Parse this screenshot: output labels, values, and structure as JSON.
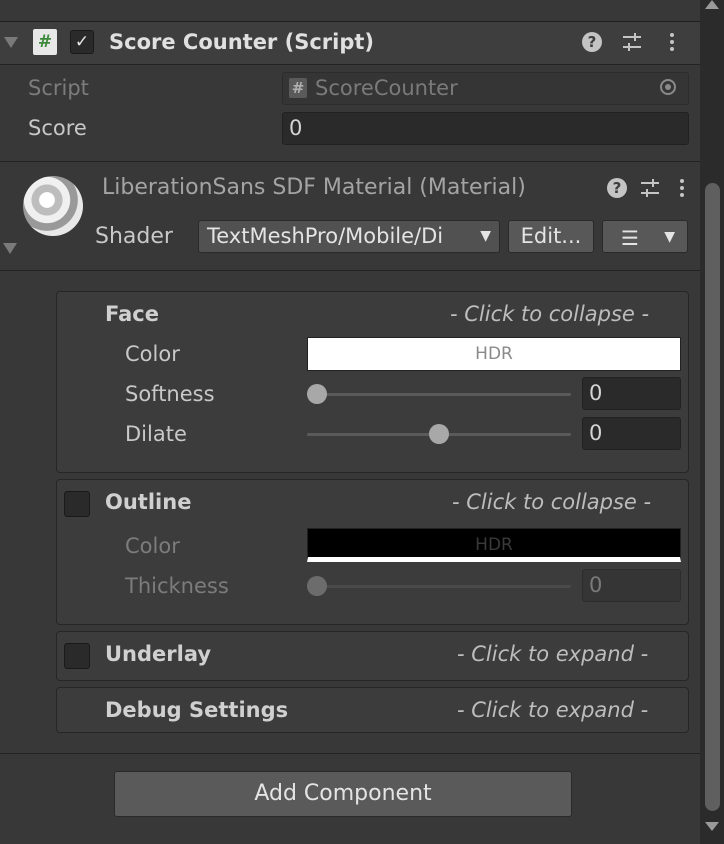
{
  "component": {
    "title": "Score Counter (Script)",
    "enabled": true,
    "icon": "hash-script-icon",
    "icon_glyph": "#",
    "checkbox_glyph": "✓",
    "help_glyph": "?",
    "settings_glyph": "⊹",
    "menu_glyph": "⋮",
    "fields": {
      "script_label": "Script",
      "script_value": "ScoreCounter",
      "script_icon_glyph": "#",
      "score_label": "Score",
      "score_value": "0"
    }
  },
  "material": {
    "title": "LiberationSans SDF Material (Material)",
    "shader_label": "Shader",
    "shader_value": "TextMeshPro/Mobile/Di",
    "edit_button": "Edit...",
    "list_glyph": "☰",
    "dropdown_glyph": "▼"
  },
  "face": {
    "title": "Face",
    "hint": "- Click to collapse -",
    "color_label": "Color",
    "color_hdr": "HDR",
    "color_value": "#ffffff",
    "softness_label": "Softness",
    "softness_value": "0",
    "softness_fraction": 0,
    "dilate_label": "Dilate",
    "dilate_value": "0",
    "dilate_fraction": 0.5
  },
  "outline": {
    "title": "Outline",
    "enabled": false,
    "hint": "- Click to collapse -",
    "color_label": "Color",
    "color_hdr": "HDR",
    "color_value": "#000000",
    "thickness_label": "Thickness",
    "thickness_value": "0",
    "thickness_fraction": 0
  },
  "underlay": {
    "title": "Underlay",
    "enabled": false,
    "hint": "- Click to expand -"
  },
  "debug": {
    "title": "Debug Settings",
    "hint": "- Click to expand -"
  },
  "add_component": "Add Component",
  "colors": {
    "panel_bg": "#383838",
    "header_bg": "#3e3e3e",
    "field_bg": "#2a2a2a",
    "button_bg": "#585858"
  }
}
